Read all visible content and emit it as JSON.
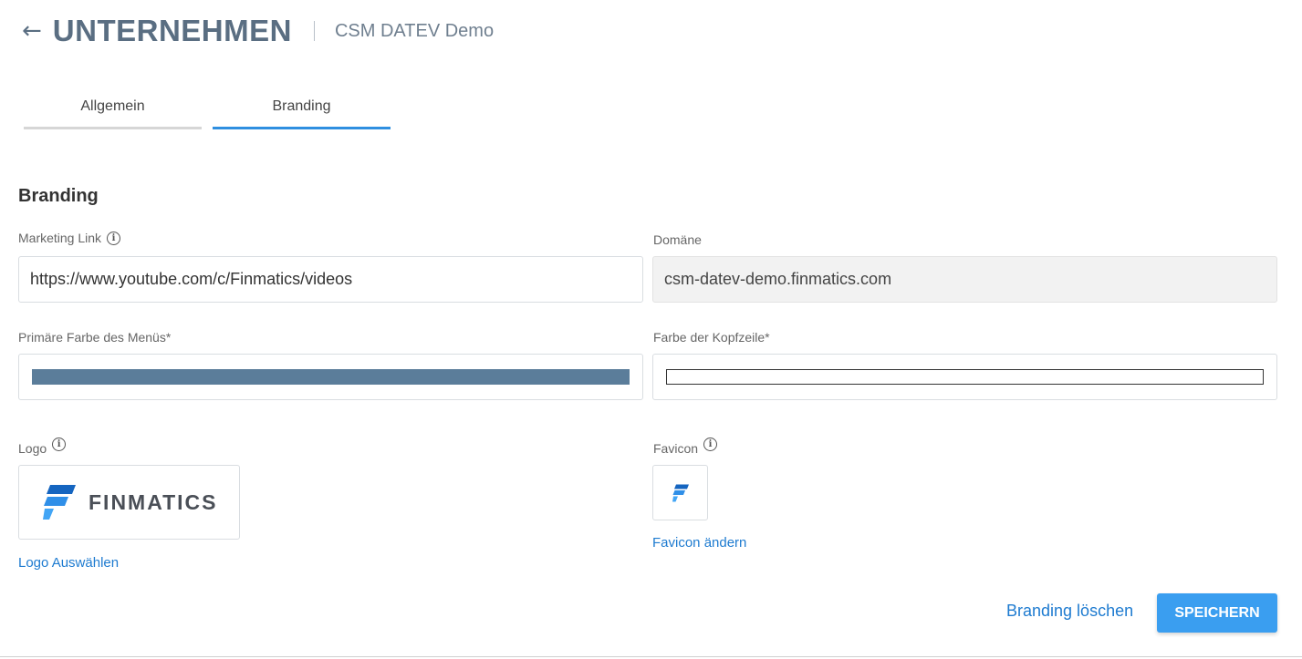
{
  "header": {
    "back_icon": "arrow-left-icon",
    "title": "UNTERNEHMEN",
    "subtitle": "CSM DATEV Demo"
  },
  "tabs": [
    {
      "label": "Allgemein",
      "active": false
    },
    {
      "label": "Branding",
      "active": true
    }
  ],
  "section": {
    "title": "Branding"
  },
  "fields": {
    "marketing_link": {
      "label": "Marketing Link",
      "value": "https://www.youtube.com/c/Finmatics/videos"
    },
    "domain": {
      "label": "Domäne",
      "value": "csm-datev-demo.finmatics.com"
    },
    "primary_menu_color": {
      "label": "Primäre Farbe des Menüs*",
      "color": "#5b7d9a"
    },
    "header_color": {
      "label": "Farbe der Kopfzeile*",
      "color": "#ffffff"
    },
    "logo": {
      "label": "Logo",
      "logo_text": "FINMATICS",
      "action": "Logo Auswählen"
    },
    "favicon": {
      "label": "Favicon",
      "action": "Favicon ändern"
    }
  },
  "actions": {
    "delete_label": "Branding löschen",
    "save_label": "SPEICHERN"
  },
  "colors": {
    "accent": "#3a9ef0",
    "link": "#1e7bd0",
    "title": "#5a6e82",
    "logo_blue_dark": "#1565c0",
    "logo_blue_light": "#42a5f5"
  }
}
